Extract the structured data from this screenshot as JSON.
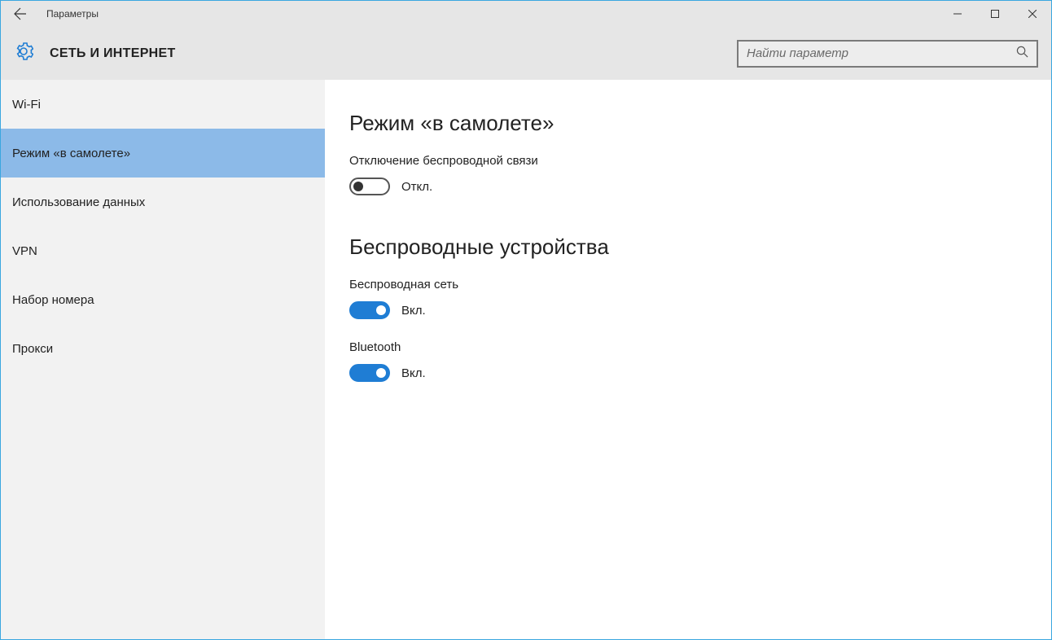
{
  "titlebar": {
    "title": "Параметры"
  },
  "header": {
    "title": "СЕТЬ И ИНТЕРНЕТ",
    "search_placeholder": "Найти параметр"
  },
  "sidebar": {
    "items": [
      {
        "label": "Wi-Fi",
        "selected": false
      },
      {
        "label": "Режим «в самолете»",
        "selected": true
      },
      {
        "label": "Использование данных",
        "selected": false
      },
      {
        "label": "VPN",
        "selected": false
      },
      {
        "label": "Набор номера",
        "selected": false
      },
      {
        "label": "Прокси",
        "selected": false
      }
    ]
  },
  "main": {
    "section1": {
      "title": "Режим «в самолете»",
      "desc": "Отключение беспроводной связи",
      "toggle": {
        "state": "off",
        "text": "Откл."
      }
    },
    "section2": {
      "title": "Беспроводные устройства",
      "wifi": {
        "label": "Беспроводная сеть",
        "state": "on",
        "text": "Вкл."
      },
      "bluetooth": {
        "label": "Bluetooth",
        "state": "on",
        "text": "Вкл."
      }
    }
  }
}
